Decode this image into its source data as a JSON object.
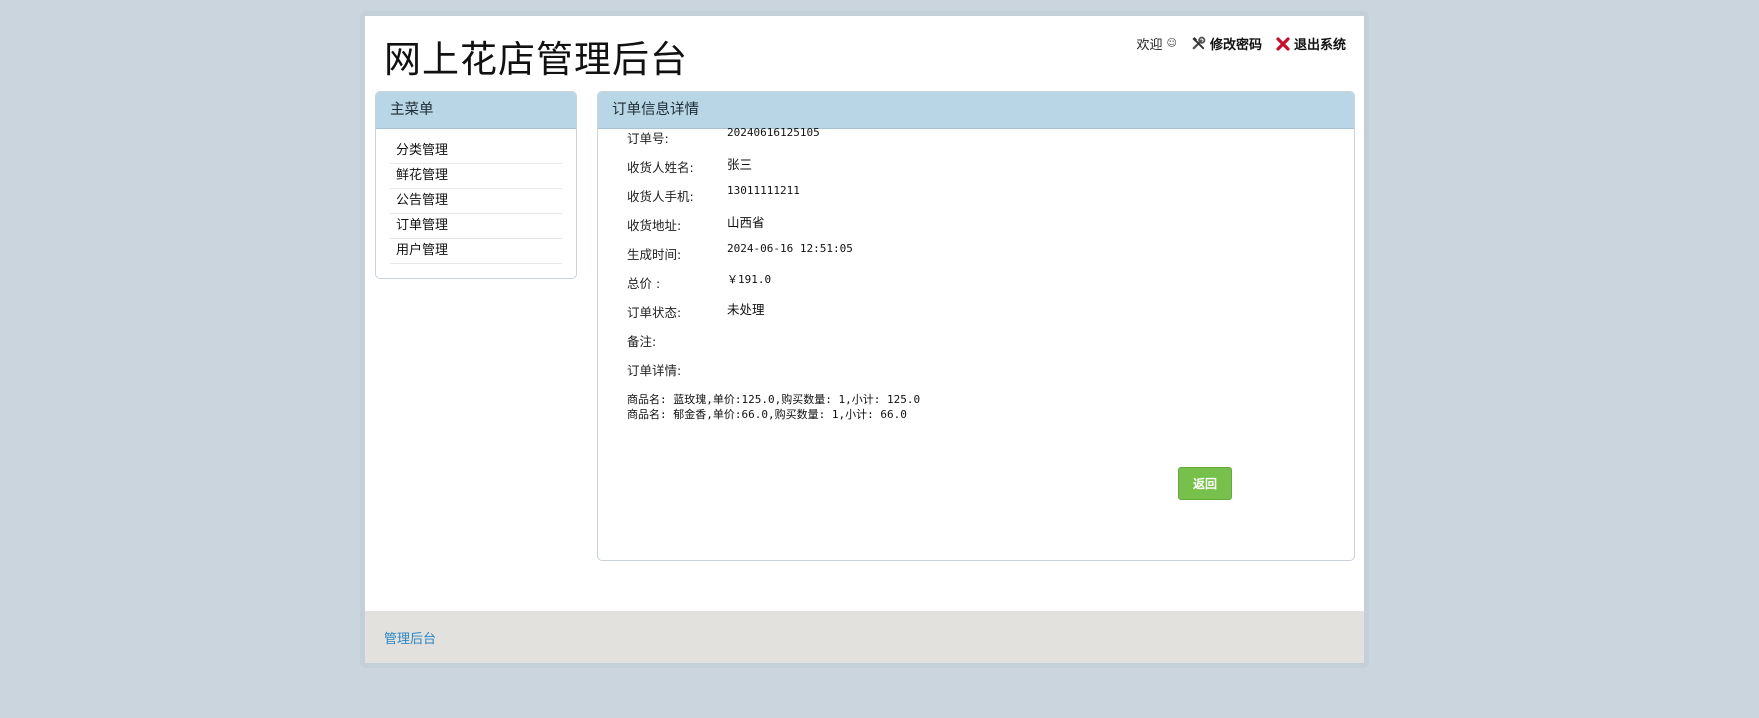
{
  "header": {
    "title": "网上花店管理后台",
    "welcome": "欢迎",
    "change_password": "修改密码",
    "logout": "退出系统"
  },
  "sidebar": {
    "title": "主菜单",
    "items": [
      {
        "label": "分类管理"
      },
      {
        "label": "鲜花管理"
      },
      {
        "label": "公告管理"
      },
      {
        "label": "订单管理"
      },
      {
        "label": "用户管理"
      }
    ]
  },
  "main": {
    "title": "订单信息详情",
    "fields": {
      "order_no": {
        "label": "订单号:",
        "value": "20240616125105"
      },
      "receiver_name": {
        "label": "收货人姓名:",
        "value": "张三"
      },
      "receiver_phone": {
        "label": "收货人手机:",
        "value": "13011111211"
      },
      "address": {
        "label": "收货地址:",
        "value": "山西省"
      },
      "created_time": {
        "label": "生成时间:",
        "value": "2024-06-16 12:51:05"
      },
      "total": {
        "label": "总价 :",
        "value": "￥191.0"
      },
      "status": {
        "label": "订单状态:",
        "value": "未处理"
      },
      "remark": {
        "label": "备注:",
        "value": ""
      },
      "details": {
        "label": "订单详情:"
      }
    },
    "items": [
      "商品名: 蓝玫瑰,单价:125.0,购买数量: 1,小计: 125.0",
      "商品名: 郁金香,单价:66.0,购买数量: 1,小计: 66.0"
    ],
    "back_button": "返回"
  },
  "footer": {
    "link": "管理后台"
  },
  "icons": {
    "tools": "tools-icon",
    "close": "close-icon",
    "user": "user-icon"
  },
  "colors": {
    "page_bg": "#cbd5dd",
    "panel_header": "#b8d6e5",
    "button": "#77c04b",
    "footer_bg": "#e3e1de",
    "link": "#2a86c2",
    "logout_icon": "#c8102e"
  }
}
